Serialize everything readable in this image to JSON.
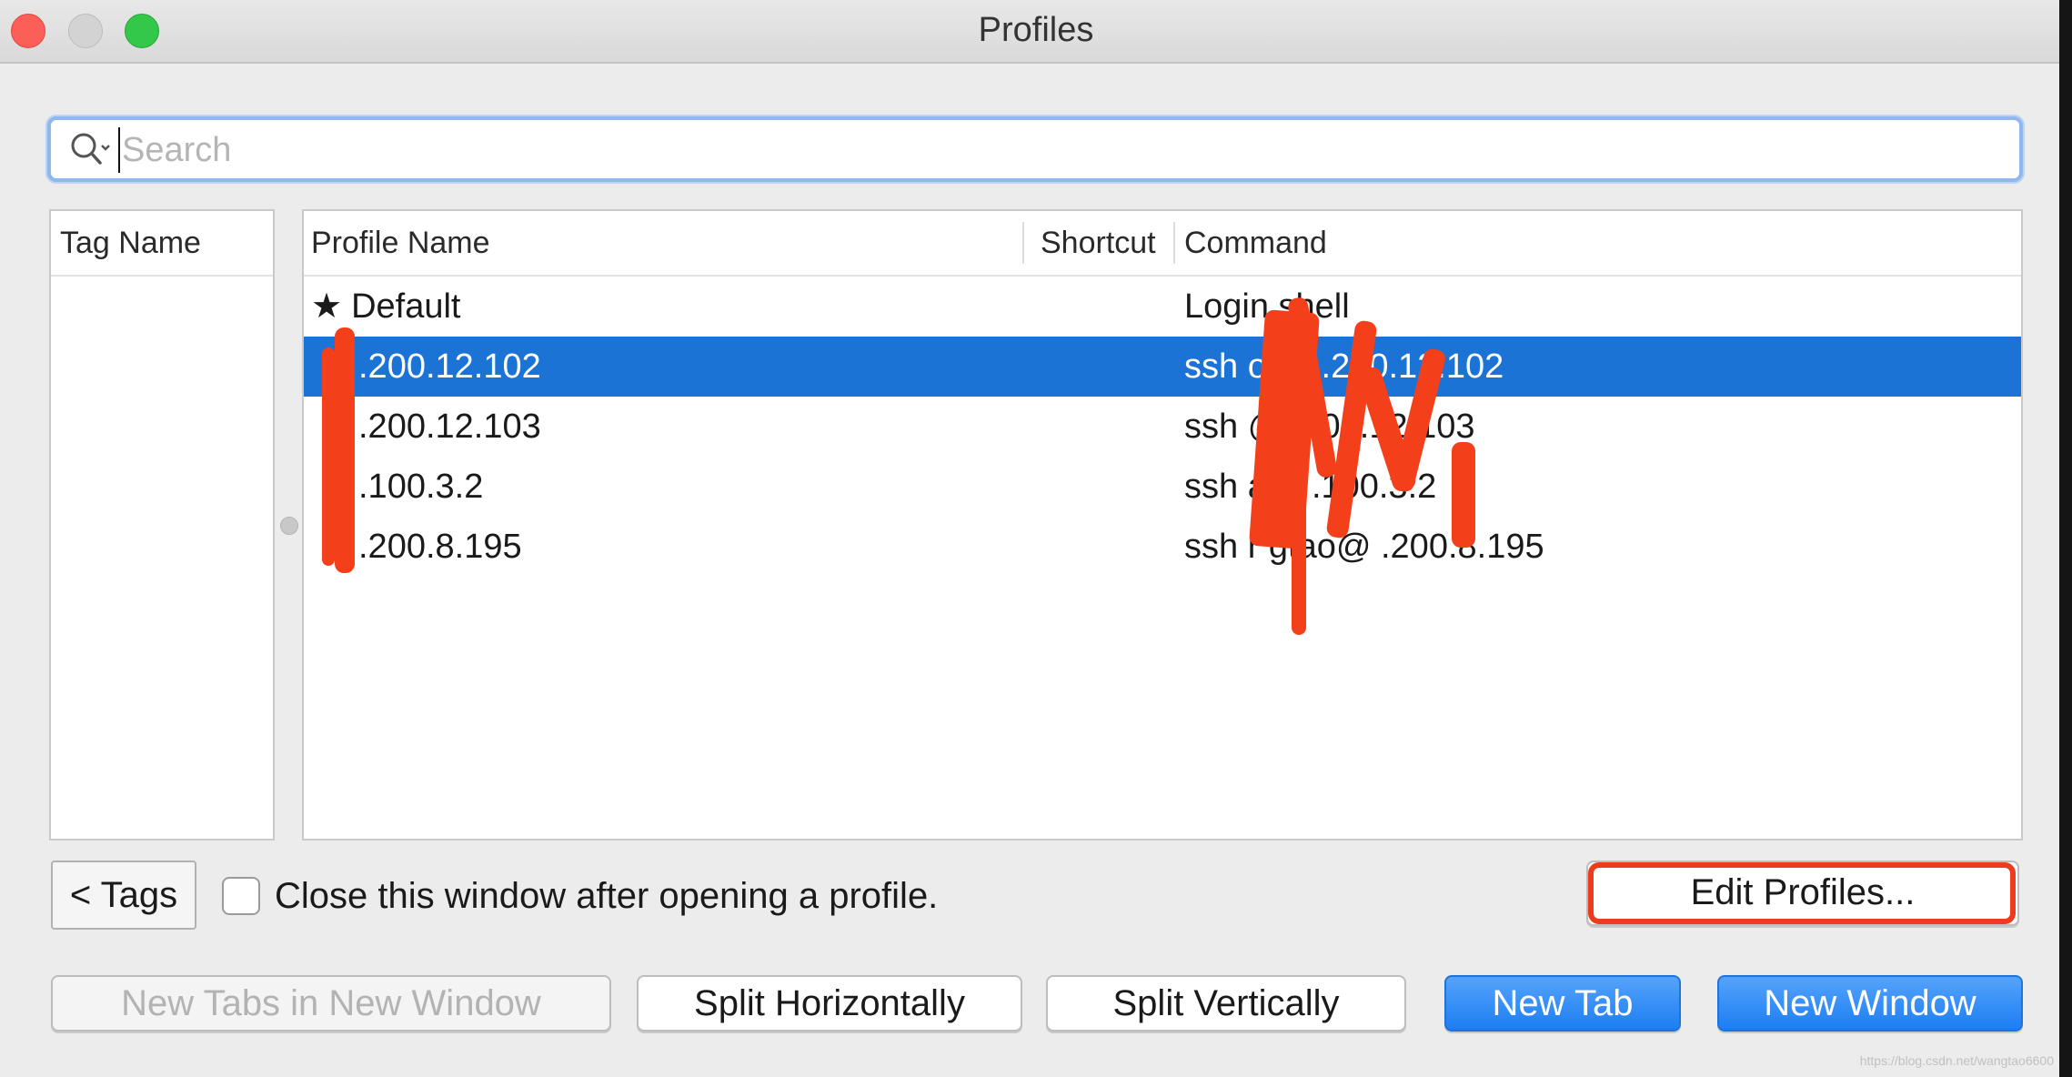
{
  "window": {
    "title": "Profiles"
  },
  "search": {
    "placeholder": "Search",
    "value": ""
  },
  "tag_panel": {
    "header": "Tag Name"
  },
  "profile_table": {
    "columns": {
      "name": "Profile Name",
      "shortcut": "Shortcut",
      "command": "Command"
    },
    "rows": [
      {
        "name": "Default",
        "starred": true,
        "star": "★",
        "shortcut": "",
        "command": "Login shell",
        "selected": false
      },
      {
        "name": ".200.12.102",
        "starred": false,
        "star": "",
        "shortcut": "",
        "command": "ssh  o  @  .200.12.102",
        "selected": true
      },
      {
        "name": ".200.12.103",
        "starred": false,
        "star": "",
        "shortcut": "",
        "command": "ssh  @  .200.12.103",
        "selected": false
      },
      {
        "name": ".100.3.2",
        "starred": false,
        "star": "",
        "shortcut": "",
        "command": "ssh  a@  .100.3.2",
        "selected": false
      },
      {
        "name": ".200.8.195",
        "starred": false,
        "star": "",
        "shortcut": "",
        "command": "ssh r  gtao@  .200.8.195",
        "selected": false
      }
    ]
  },
  "controls": {
    "tags_button": "< Tags",
    "close_after_open_label": "Close this window after opening a profile.",
    "close_after_open_checked": false,
    "edit_profiles_button": "Edit Profiles..."
  },
  "actions": {
    "new_tabs_in_new_window": "New Tabs in New Window",
    "split_horizontally": "Split Horizontally",
    "split_vertically": "Split Vertically",
    "new_tab": "New Tab",
    "new_window": "New Window"
  },
  "colors": {
    "selection": "#1b74d5",
    "primary_button": "#1c7ef2",
    "redaction": "#f3401a",
    "highlight": "#ef3b1d"
  },
  "watermark": "https://blog.csdn.net/wangtao6600"
}
